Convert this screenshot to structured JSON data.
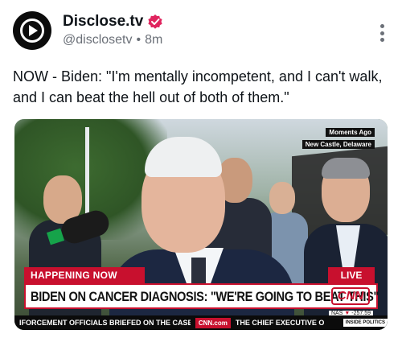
{
  "author": {
    "display_name": "Disclose.tv",
    "handle": "@disclosetv",
    "separator": "•",
    "time": "8m",
    "avatar_icon": "play-circle-icon",
    "verified_icon": "verified-badge-icon",
    "verified_color": "#e0245e"
  },
  "menu": {
    "icon": "more-vertical-icon"
  },
  "post": {
    "text": "NOW - Biden: \"I'm mentally incompetent, and I can't walk, and I can beat the hell out of both of them.\""
  },
  "media": {
    "corner_tag_line1": "Moments Ago",
    "corner_tag_line2": "New Castle, Delaware",
    "happening_label": "HAPPENING NOW",
    "live_label": "LIVE",
    "headline": "BIDEN ON CANCER DIAGNOSIS: \"WE'RE GOING TO BEAT THIS\"",
    "network_logo": "CNN",
    "stock_label": "NAS",
    "stock_arrow": "▼",
    "stock_value": "-257.59",
    "ticker_left": "IFORCEMENT OFFICIALS BRIEFED ON THE CASE.",
    "ticker_brand": "CNN.com",
    "ticker_right": "THE CHIEF EXECUTIVE O",
    "ticker_tag": "INSIDE POLITICS",
    "accent_color": "#c8102e"
  }
}
